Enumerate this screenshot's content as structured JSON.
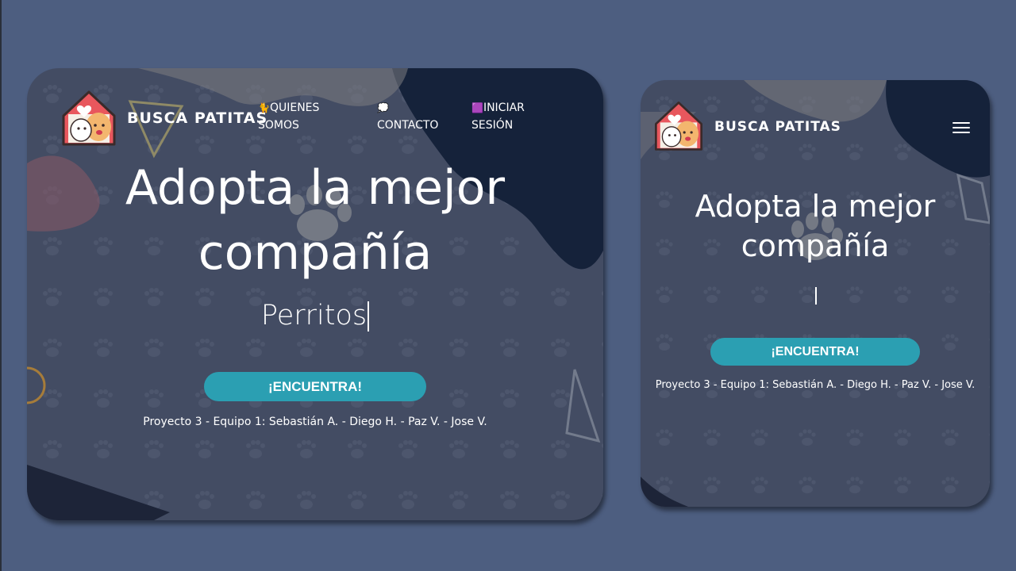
{
  "brand": {
    "name": "BUSCA PATITAS"
  },
  "nav": {
    "about": {
      "icon": "cat-icon",
      "label": "QUIENES SOMOS"
    },
    "contact": {
      "icon": "speech-bubble-icon",
      "label": "CONTACTO"
    },
    "login": {
      "icon": "purple-box-icon",
      "label": "INICIAR SESIÓN"
    }
  },
  "desktop": {
    "title": "Adopta la mejor compañía",
    "typed_text": "Perritos",
    "cta_label": "¡ENCUENTRA!",
    "credits": "Proyecto 3 - Equipo 1: Sebastián A. - Diego H. - Paz V. - Jose V."
  },
  "mobile": {
    "title_line1": "Adopta la mejor",
    "title_line2": "compañía",
    "typed_text": "",
    "cta_label": "¡ENCUENTRA!",
    "credits": "Proyecto 3 - Equipo 1: Sebastián A. - Diego H. - Paz V. - Jose V.",
    "menu_icon": "hamburger-menu-icon"
  },
  "colors": {
    "page_background": "#4d5e80",
    "card_background": "#434c63",
    "dark_blob": "#15223a",
    "cta_button": "#2b9fb2",
    "logo_roof": "#e8575d"
  }
}
